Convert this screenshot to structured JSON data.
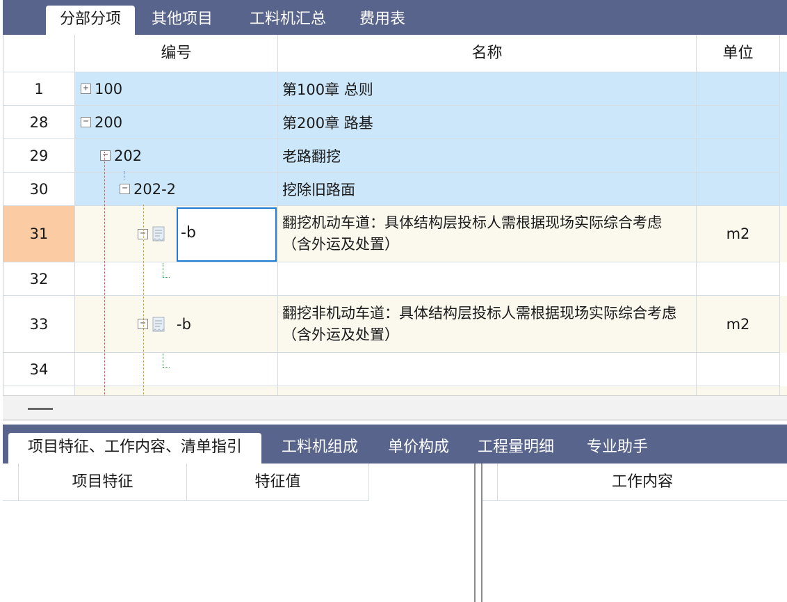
{
  "top_tabs": [
    "分部分项",
    "其他项目",
    "工料机汇总",
    "费用表"
  ],
  "grid": {
    "columns": {
      "code": "编号",
      "name": "名称",
      "unit": "单位"
    },
    "rows": [
      {
        "num": "1",
        "code": "100",
        "name": "第100章 总则",
        "unit": "",
        "toggle": "⊞"
      },
      {
        "num": "28",
        "code": "200",
        "name": "第200章 路基",
        "unit": "",
        "toggle": "⊟"
      },
      {
        "num": "29",
        "code": "202",
        "name": "老路翻挖",
        "unit": "",
        "toggle": "⊟"
      },
      {
        "num": "30",
        "code": "202-2",
        "name": "挖除旧路面",
        "unit": "",
        "toggle": "⊟"
      },
      {
        "num": "31",
        "code": "-b",
        "name": "翻挖机动车道：具体结构层投标人需根据现场实际综合考虑（含外运及处置）",
        "unit": "m2",
        "toggle": "⊟"
      },
      {
        "num": "32",
        "code": "",
        "name": "",
        "unit": ""
      },
      {
        "num": "33",
        "code": "-b",
        "name": "翻挖非机动车道：具体结构层投标人需根据现场实际综合考虑（含外运及处置）",
        "unit": "m2",
        "toggle": "⊟"
      },
      {
        "num": "34",
        "code": "",
        "name": "",
        "unit": ""
      }
    ]
  },
  "bottom_tabs": [
    "项目特征、工作内容、清单指引",
    "工料机组成",
    "单价构成",
    "工程量明细",
    "专业助手"
  ],
  "features_table": {
    "col1": "项目特征",
    "col2": "特征值"
  },
  "work_table": {
    "col1": "工作内容"
  },
  "colors": {
    "tabbar": "#58648c",
    "group_row": "#cce7f9",
    "item_row": "#fbf8ee",
    "selected_rownum": "#fbcba3",
    "focus_border": "#1e7bd6"
  }
}
